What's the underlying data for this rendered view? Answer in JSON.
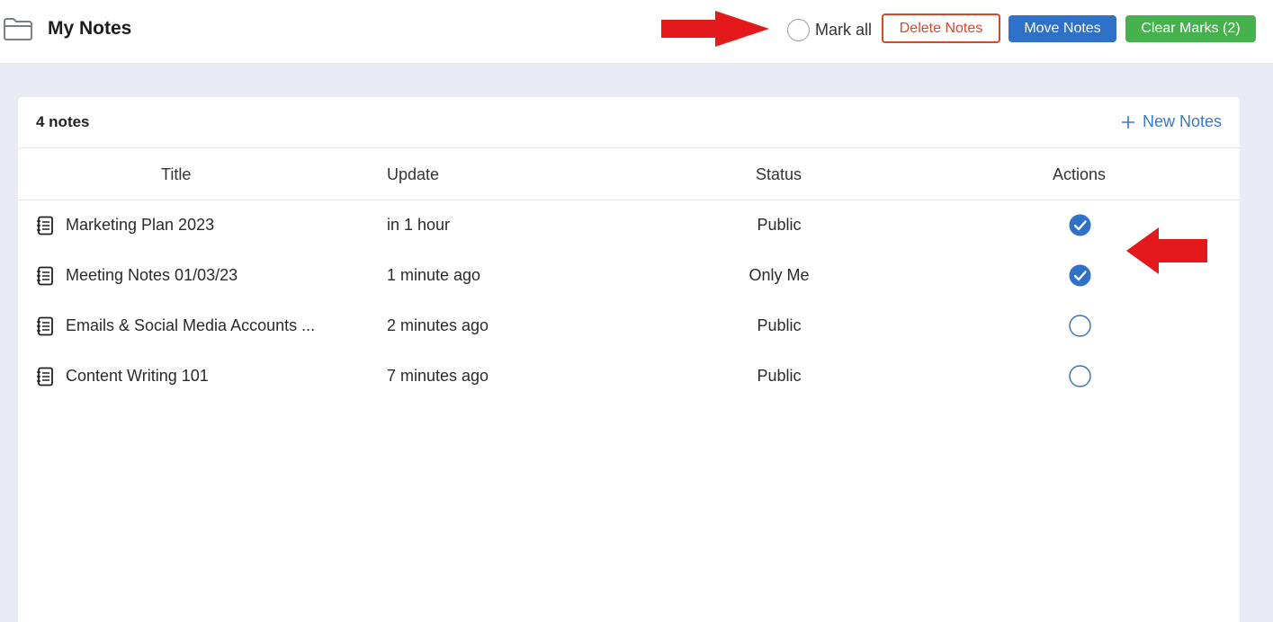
{
  "header": {
    "title": "My Notes",
    "mark_all_label": "Mark all",
    "delete_label": "Delete Notes",
    "move_label": "Move Notes",
    "clear_label": "Clear Marks (2)"
  },
  "card": {
    "count_label": "4 notes",
    "new_notes_label": "New Notes",
    "columns": [
      "Title",
      "Update",
      "Status",
      "Actions"
    ]
  },
  "notes": [
    {
      "title": "Marketing Plan 2023",
      "update": "in 1 hour",
      "status": "Public",
      "checked": true
    },
    {
      "title": "Meeting Notes 01/03/23",
      "update": "1 minute ago",
      "status": "Only Me",
      "checked": true
    },
    {
      "title": "Emails & Social Media Accounts ...",
      "update": "2 minutes ago",
      "status": "Public",
      "checked": false
    },
    {
      "title": "Content Writing 101",
      "update": "7 minutes ago",
      "status": "Public",
      "checked": false
    }
  ],
  "colors": {
    "accent_blue": "#2f70c9",
    "danger_red": "#d9472b",
    "success_green": "#45b24d",
    "annotation_red": "#e3191c",
    "page_bg": "#e8ebf3"
  },
  "icons": {
    "folder": "folder-icon",
    "note": "note-list-icon",
    "checked": "check-circle-icon",
    "unchecked": "empty-circle-icon",
    "plus": "plus-icon"
  }
}
